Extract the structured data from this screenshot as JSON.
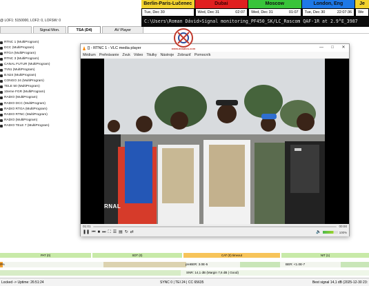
{
  "monitor": {
    "status_line": "@ LOF1: 5150000, LOF2: 0, LOFSW: 0",
    "tabs": [
      {
        "label": ""
      },
      {
        "label": "Signal Mon."
      },
      {
        "label": "TSA (D4)"
      },
      {
        "label": "AV Player"
      }
    ],
    "programs": [
      "RTNC 1 (MultiProgram)",
      "DCC (MultiProgram)",
      "RTGA (MultiProgram)",
      "RTNC 3 (MultiProgram)",
      "CANAL FUTUR (MultiProgram)",
      "TV51 (MultiProgram)",
      "B.N24 (MultiProgram)",
      "CONGO 24 (MultiProgram)",
      "TELE 50 (MultiProgram)",
      "10eme FGR (MultiProgram)",
      "RADIO (MultiProgram)",
      "RADIO DCC (MultiProgram)",
      "RADIO RTGA (MultiProgram)",
      "RADIO RTNC (MultiProgram)",
      "RADIO (MultiProgram)",
      "RADIO TELE 7 (MultiProgram)"
    ]
  },
  "clocks": [
    {
      "city": "Berlin-Paris-Lučenec",
      "date": "Tue, Dec 30",
      "time": "",
      "bg": "#f2d22e",
      "fg": "#111111"
    },
    {
      "city": "Dubai",
      "date": "Wed, Dec 31",
      "time": "02:07",
      "bg": "#e02020",
      "fg": "#3a0000"
    },
    {
      "city": "Moscow",
      "date": "Wed, Dec 31",
      "time": "01:07",
      "bg": "#39c43a",
      "fg": "#111111"
    },
    {
      "city": "London, Eng",
      "date": "Tue, Dec 30",
      "time": "22:07:36",
      "bg": "#1e78e6",
      "fg": "#111111"
    },
    {
      "city": "Je",
      "date": "We",
      "time": "",
      "bg": "#f2d22e",
      "fg": "#111111"
    }
  ],
  "terminal": {
    "text": "C:\\Users\\Roman Dávid>Signal monitoring_PF450_SK/LC_Rascom QAF-1R at 2.9°E_3987"
  },
  "vlc": {
    "title": "[] - RTNC 1 - VLC media player",
    "menu": [
      "Médium",
      "Prehrávanie",
      "Zvuk",
      "Video",
      "Titulky",
      "Nástroje",
      "Zobraziť",
      "Pomocník"
    ],
    "time_elapsed": "01:01",
    "time_total": "00:00",
    "volume": "100%",
    "volume_level": 0.7,
    "video_caption": "RNAL"
  },
  "logo": {
    "text": "www.dxsatcs.com",
    "color": "#c0392b"
  },
  "meters": {
    "row1": [
      "PAT (0)",
      "SDT (0)",
      "CAT (0) timeout",
      "NIT (1)"
    ],
    "row2_left": "0%",
    "preber": "preBER: 3.0E-5",
    "ber": "BER: <1.0E-7",
    "snr": "SNR: 14,1 dB (Margin 7,6 dB | Good)"
  },
  "status_bar": {
    "left": "Locked -> Uptime: 26:51:24",
    "middle": "SYNC 0 | TEI 24 | CC 65635",
    "right": "Best signal 14,1 dB (2025-12-30 23:"
  }
}
